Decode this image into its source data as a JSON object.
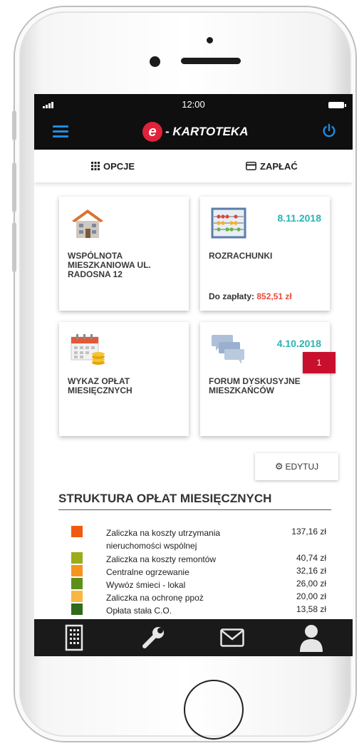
{
  "status": {
    "time": "12:00"
  },
  "app": {
    "logo_letter": "e",
    "name": "- KARTOTEKA",
    "brand_color": "#e0233a",
    "accent_color": "#1f8ce0"
  },
  "tabs": [
    {
      "label": "OPCJE",
      "icon": "grid-icon"
    },
    {
      "label": "ZAPŁAĆ",
      "icon": "card-icon"
    }
  ],
  "cards": [
    {
      "title": "WSPÓLNOTA MIESZKANIOWA UL. RADOSNA 12",
      "icon": "house-icon"
    },
    {
      "title": "ROZRACHUNKI",
      "date": "8.11.2018",
      "due_label": "Do zapłaty:",
      "due_amount": "852,51 zł",
      "icon": "abacus-icon"
    },
    {
      "title": "WYKAZ OPŁAT MIESIĘCZNYCH",
      "icon": "calendar-coins-icon"
    },
    {
      "title": "FORUM DYSKUSYJNE MIESZKAŃCÓW",
      "date": "4.10.2018",
      "badge": "1",
      "icon": "chat-bubbles-icon"
    }
  ],
  "edit_button": {
    "label": "EDYTUJ",
    "icon": "gear-icon"
  },
  "fees": {
    "title": "STRUKTURA OPŁAT MIESIĘCZNYCH",
    "items": [
      {
        "label": "Zaliczka na koszty utrzymania nieruchomości wspólnej",
        "value": "137,16 zł",
        "color": "#ef5a10"
      },
      {
        "label": "Zaliczka na koszty remontów",
        "value": "40,74 zł",
        "color": "#9cac1a"
      },
      {
        "label": "Centralne ogrzewanie",
        "value": "32,16 zł",
        "color": "#f7941d"
      },
      {
        "label": "Wywóz śmieci - lokal",
        "value": "26,00 zł",
        "color": "#5d8f1b"
      },
      {
        "label": "Zaliczka na ochronę ppoż",
        "value": "20,00 zł",
        "color": "#f9b642"
      },
      {
        "label": "Opłata stała C.O.",
        "value": "13,58 zł",
        "color": "#2f6b1a"
      }
    ]
  },
  "bottom_nav": [
    "building-icon",
    "wrench-icon",
    "mail-icon",
    "user-icon"
  ]
}
